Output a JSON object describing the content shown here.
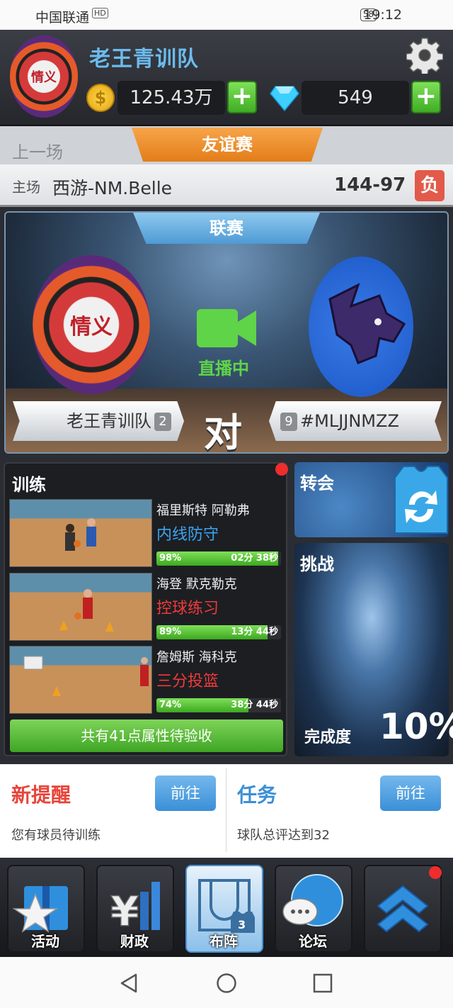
{
  "status_bar": {
    "carrier": "中国联通",
    "network": "HD",
    "battery": "58",
    "time": "19:12"
  },
  "header": {
    "team_name": "老王青训队",
    "coins": "125.43万",
    "diamonds": "549",
    "emblem_text": "情义"
  },
  "last_game": {
    "label": "上一场",
    "tab": "友谊赛",
    "home_label": "主场",
    "opponent": "西游-NM.Belle",
    "score": "144-97",
    "result": "负"
  },
  "match": {
    "tab": "联赛",
    "live": "直播中",
    "home_team": "老王青训队",
    "home_rank": "2",
    "away_team": "#MLJJNMZZ",
    "away_rank": "9",
    "vs": "对"
  },
  "training": {
    "title": "训练",
    "items": [
      {
        "player": "福里斯特 阿勒弗",
        "drill": "内线防守",
        "drill_color": "#3da4f0",
        "percent": "98%",
        "progress": 0.98,
        "time": "02分 38秒"
      },
      {
        "player": "海登 默克勒克",
        "drill": "控球练习",
        "drill_color": "#f03a3a",
        "percent": "89%",
        "progress": 0.89,
        "time": "13分 44秒"
      },
      {
        "player": "詹姆斯 海科克",
        "drill": "三分投篮",
        "drill_color": "#f03a3a",
        "percent": "74%",
        "progress": 0.74,
        "time": "38分 44秒"
      }
    ],
    "accept_label": "共有41点属性待验收"
  },
  "transfer": {
    "title": "转会"
  },
  "challenge": {
    "title": "挑战",
    "complete_label": "完成度",
    "complete_pct": "10%"
  },
  "reminder": {
    "title": "新提醒",
    "go": "前往",
    "desc": "您有球员待训练",
    "title_color": "#e8443a"
  },
  "task": {
    "title": "任务",
    "go": "前往",
    "desc": "球队总评达到32",
    "title_color": "#3a8fd6"
  },
  "nav": {
    "items": [
      {
        "label": "活动"
      },
      {
        "label": "财政"
      },
      {
        "label": "布阵"
      },
      {
        "label": "论坛"
      },
      {
        "label": ""
      }
    ]
  }
}
